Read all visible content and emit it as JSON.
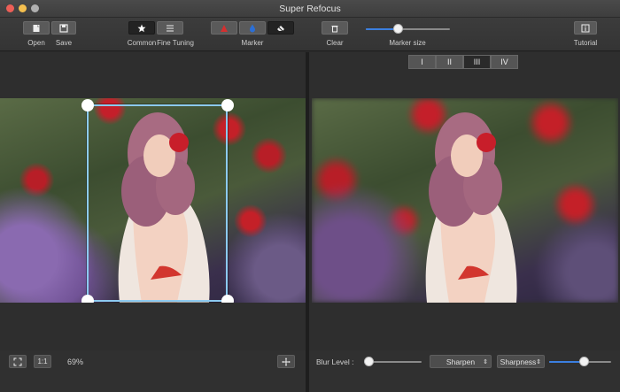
{
  "window": {
    "title": "Super Refocus"
  },
  "toolbar": {
    "open_label": "Open",
    "save_label": "Save",
    "common_label": "Common",
    "fine_tuning_label": "Fine Tuning",
    "marker_label": "Marker",
    "clear_label": "Clear",
    "marker_size_label": "Marker size",
    "marker_size_value": 0.38,
    "tutorial_label": "Tutorial"
  },
  "preview_tabs": [
    "I",
    "II",
    "III",
    "IV"
  ],
  "bottom_left": {
    "fit_label": "1:1",
    "zoom": "69%"
  },
  "bottom_right": {
    "blur_label": "Blur Level :",
    "blur_value": 0.08,
    "sharpen_label": "Sharpen",
    "sharpness_label": "Sharpness",
    "sharpness_value": 0.55
  },
  "colors": {
    "accent": "#3b7fe0",
    "selection": "#8ccaf0",
    "marker_red": "#d43030",
    "marker_blue": "#2b6fd6"
  }
}
